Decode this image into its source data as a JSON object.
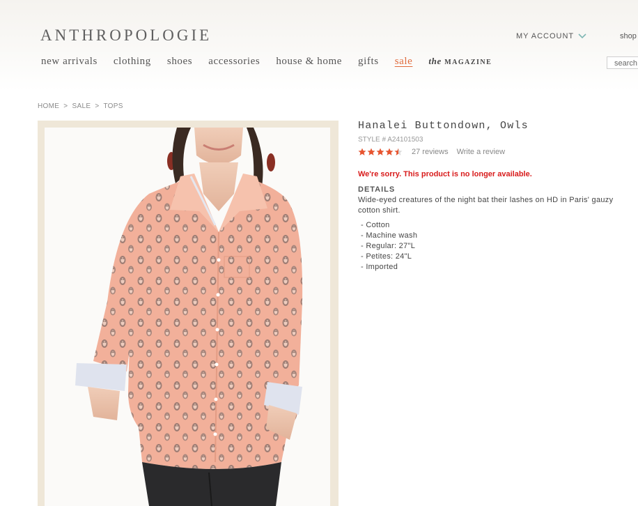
{
  "header": {
    "logo": "ANTHROPOLOGIE",
    "account": "MY ACCOUNT",
    "shop": "shop",
    "search_placeholder": "search"
  },
  "nav": {
    "items": [
      {
        "label": "new arrivals"
      },
      {
        "label": "clothing"
      },
      {
        "label": "shoes"
      },
      {
        "label": "accessories"
      },
      {
        "label": "house & home"
      },
      {
        "label": "gifts"
      },
      {
        "label": "sale"
      }
    ],
    "magazine_the": "the",
    "magazine_word": "MAGAZINE"
  },
  "breadcrumb": [
    "HOME",
    ">",
    "SALE",
    ">",
    "TOPS"
  ],
  "product": {
    "title": "Hanalei Buttondown, Owls",
    "style": "STYLE # A24101503",
    "rating": 4.5,
    "reviews": "27 reviews",
    "write_review": "Write a review",
    "unavailable": "We're sorry. This product is no longer available.",
    "details_heading": "DETAILS",
    "description": "Wide-eyed creatures of the night bat their lashes on HD in Paris' gauzy cotton shirt.",
    "bullets": [
      "- Cotton",
      "- Machine wash",
      "- Regular: 27\"L",
      "- Petites: 24\"L",
      "- Imported"
    ]
  },
  "colors": {
    "accent_sale": "#e06a3b",
    "star": "#e8542f",
    "error": "#d81b1b",
    "shirt": "#f2b09a"
  }
}
